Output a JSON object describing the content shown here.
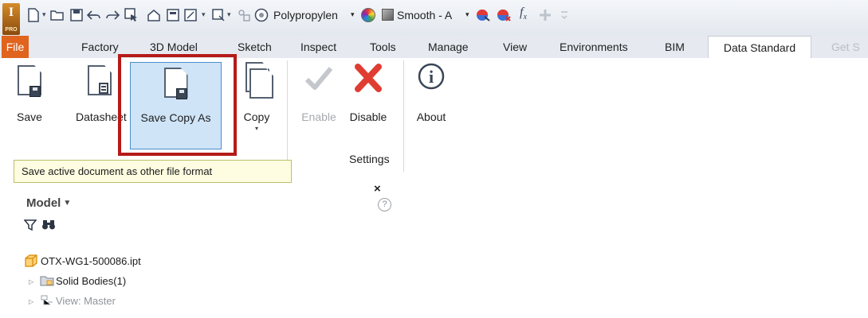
{
  "app": {
    "badge": "I",
    "edition": "PRO"
  },
  "qat": {
    "material": "Polypropylen",
    "appearance": "Smooth - A",
    "fx": "f",
    "fx_sub": "x"
  },
  "tabs": [
    {
      "label": "File"
    },
    {
      "label": "Factory"
    },
    {
      "label": "3D Model"
    },
    {
      "label": "Sketch"
    },
    {
      "label": "Inspect"
    },
    {
      "label": "Tools"
    },
    {
      "label": "Manage"
    },
    {
      "label": "View"
    },
    {
      "label": "Environments"
    },
    {
      "label": "BIM"
    },
    {
      "label": "Data Standard"
    },
    {
      "label": "Get S"
    }
  ],
  "ribbon": {
    "buttons": {
      "save": "Save",
      "datasheet": "Datasheet",
      "save_copy_as": "Save Copy As",
      "copy": "Copy",
      "enable": "Enable",
      "disable": "Disable",
      "about": "About"
    },
    "panel_title": "Settings",
    "copy_dropdown": "▾"
  },
  "tooltip": "Save active document as other file format",
  "browser": {
    "title": "Model",
    "close": "×",
    "help": "?",
    "tree": [
      {
        "label": "OTX-WG1-500086.ipt"
      },
      {
        "label": "Solid Bodies(1)"
      },
      {
        "label": "View: Master"
      }
    ]
  },
  "colors": {
    "file_tab": "#e0631e",
    "highlight_border": "#b51a18",
    "tooltip_bg": "#fefde1",
    "selected_button": "#cfe4f7",
    "disable_icon": "#e03d32"
  }
}
